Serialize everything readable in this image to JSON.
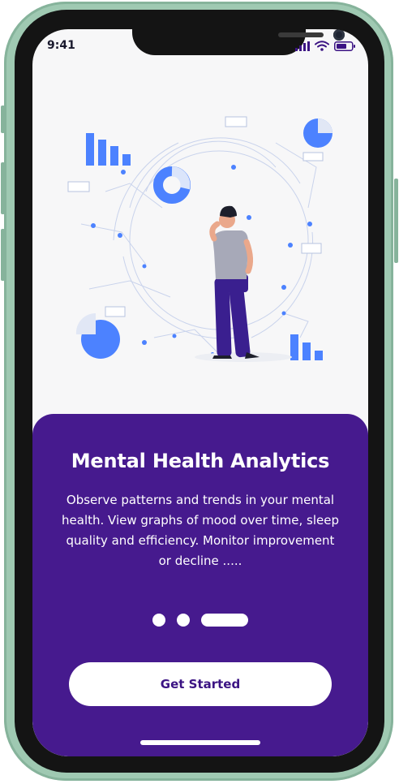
{
  "status_bar": {
    "time": "9:41"
  },
  "onboarding": {
    "title": "Mental Health Analytics",
    "description": "Observe patterns and trends in your mental health. View graphs of mood over time, sleep quality and efficiency. Monitor improvement or decline .....",
    "cta_label": "Get Started",
    "page_indicator": {
      "total": 3,
      "active_index": 2
    }
  },
  "colors": {
    "card_background": "#461a8e",
    "accent_blue": "#4c82ff",
    "figure_pants": "#3a1f8f",
    "phone_frame": "#9fc9b2"
  },
  "icons": {
    "signal": "cellular-signal-icon",
    "wifi": "wifi-icon",
    "battery": "battery-icon"
  }
}
